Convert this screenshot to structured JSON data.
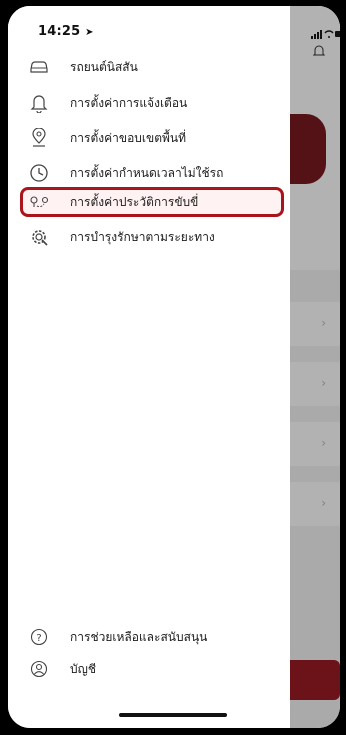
{
  "status_bar": {
    "time": "14:25"
  },
  "menu": {
    "items": [
      {
        "label": "รถยนต์นิสสัน",
        "icon": "car-icon"
      },
      {
        "label": "การตั้งค่าการแจ้งเตือน",
        "icon": "bell-icon"
      },
      {
        "label": "การตั้งค่าขอบเขตพื้นที่",
        "icon": "location-pin-icon"
      },
      {
        "label": "การตั้งค่ากำหนดเวลาไม่ใช้รถ",
        "icon": "clock-icon"
      },
      {
        "label": "การตั้งค่าประวัติการขับขี่",
        "icon": "route-icon",
        "selected": true
      },
      {
        "label": "การบำรุงรักษาตามระยะทาง",
        "icon": "gear-icon"
      }
    ],
    "bottom_items": [
      {
        "label": "การช่วยเหลือและสนับสนุน",
        "icon": "help-circle-icon"
      },
      {
        "label": "บัญชี",
        "icon": "user-circle-icon"
      }
    ]
  },
  "colors": {
    "accent": "#a8151b",
    "highlight_bg": "#fff2f3"
  }
}
